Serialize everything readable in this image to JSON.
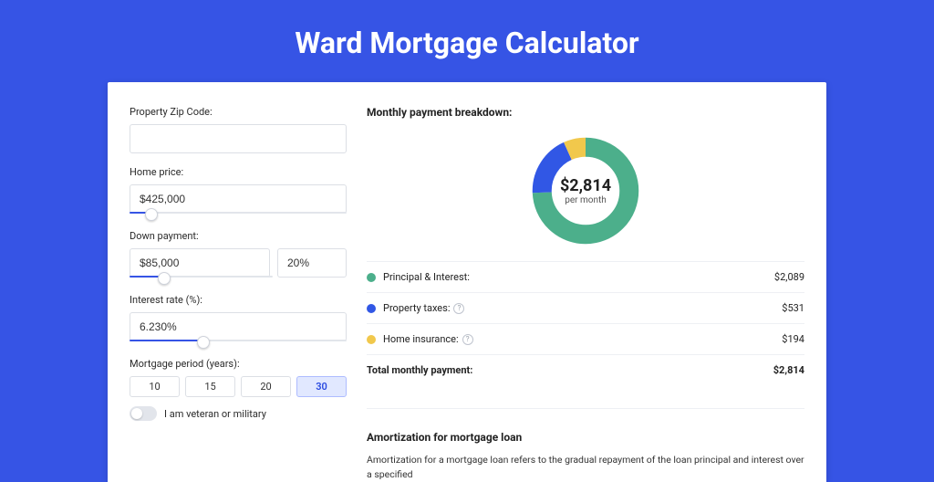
{
  "title": "Ward Mortgage Calculator",
  "form": {
    "zip": {
      "label": "Property Zip Code:",
      "value": ""
    },
    "price": {
      "label": "Home price:",
      "value": "$425,000",
      "slider_pct": 10
    },
    "down": {
      "label": "Down payment:",
      "amount": "$85,000",
      "pct": "20%",
      "slider_pct": 24
    },
    "rate": {
      "label": "Interest rate (%):",
      "value": "6.230%",
      "slider_pct": 34
    },
    "period": {
      "label": "Mortgage period (years):",
      "options": [
        "10",
        "15",
        "20",
        "30"
      ],
      "selected": "30"
    },
    "veteran": {
      "label": "I am veteran or military",
      "on": false
    }
  },
  "breakdown": {
    "heading": "Monthly payment breakdown:",
    "center_amount": "$2,814",
    "center_sub": "per month",
    "items": [
      {
        "label": "Principal & Interest:",
        "value": "$2,089",
        "color": "#4caf8b",
        "help": false
      },
      {
        "label": "Property taxes:",
        "value": "$531",
        "color": "#3157e5",
        "help": true
      },
      {
        "label": "Home insurance:",
        "value": "$194",
        "color": "#f1c84c",
        "help": true
      }
    ],
    "total_label": "Total monthly payment:",
    "total_value": "$2,814"
  },
  "amort": {
    "heading": "Amortization for mortgage loan",
    "text": "Amortization for a mortgage loan refers to the gradual repayment of the loan principal and interest over a specified"
  },
  "chart_data": {
    "type": "pie",
    "title": "Monthly payment breakdown",
    "series": [
      {
        "name": "Principal & Interest",
        "value": 2089,
        "color": "#4caf8b"
      },
      {
        "name": "Property taxes",
        "value": 531,
        "color": "#3157e5"
      },
      {
        "name": "Home insurance",
        "value": 194,
        "color": "#f1c84c"
      }
    ],
    "total": 2814,
    "center_label": "$2,814 per month",
    "donut": true
  }
}
